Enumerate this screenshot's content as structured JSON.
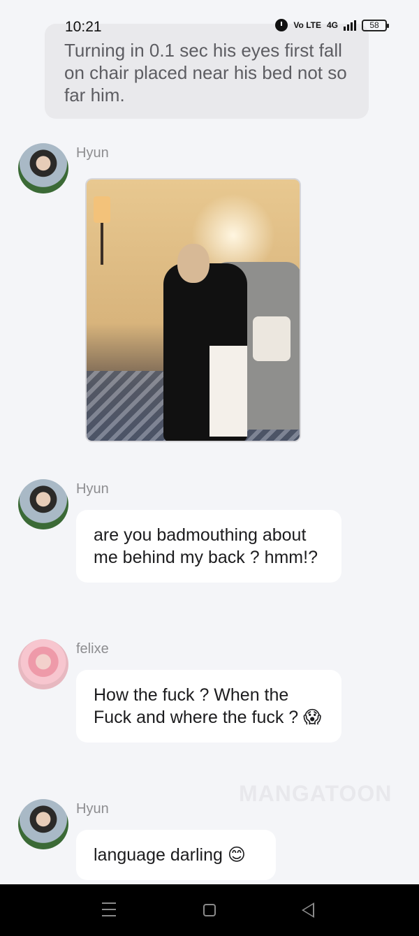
{
  "status_bar": {
    "time": "10:21",
    "network_label_1": "Vo LTE",
    "network_label_2": "4G",
    "battery": "58"
  },
  "narration": "Turning in 0.1 sec his eyes first fall on chair placed near his bed not so far him.",
  "messages": [
    {
      "sender": "Hyun",
      "type": "image"
    },
    {
      "sender": "Hyun",
      "text": "are you badmouthing about me behind my back ? hmm!?"
    },
    {
      "sender": "felixe",
      "text": "How the fuck ? When the Fuck and where the fuck ? 😱"
    },
    {
      "sender": "Hyun",
      "text": "language darling 😊"
    }
  ],
  "watermark": "MANGATOON",
  "nav": {
    "icons": [
      "menu-icon",
      "home-icon",
      "back-icon"
    ]
  }
}
